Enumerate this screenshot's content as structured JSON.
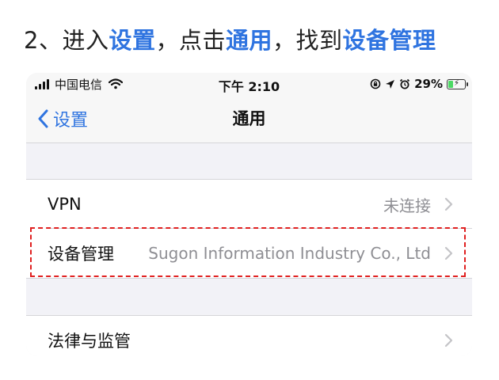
{
  "instruction": {
    "prefix": "2、进入",
    "highlight1": "设置",
    "sep1": "，点击",
    "highlight2": "通用",
    "sep2": "，找到",
    "highlight3": "设备管理",
    "accent_color": "#2f74e0"
  },
  "status_bar": {
    "carrier": "中国电信",
    "time": "下午 2:10",
    "battery_percent": "29%",
    "battery_level": 0.29,
    "icons": [
      "signal-icon",
      "wifi-icon",
      "rotation-lock-icon",
      "location-icon",
      "alarm-icon",
      "battery-icon"
    ]
  },
  "nav": {
    "back_label": "设置",
    "title": "通用"
  },
  "groups": [
    {
      "rows": [
        {
          "label": "VPN",
          "value": "未连接"
        },
        {
          "label": "设备管理",
          "value": "Sugon Information Industry Co., Ltd",
          "highlighted": true
        }
      ]
    },
    {
      "rows": [
        {
          "label": "法律与监管",
          "value": ""
        }
      ]
    }
  ],
  "colors": {
    "highlight_border": "#e02020",
    "ios_blue": "#2f74e0",
    "secondary_text": "#8e8e93"
  }
}
